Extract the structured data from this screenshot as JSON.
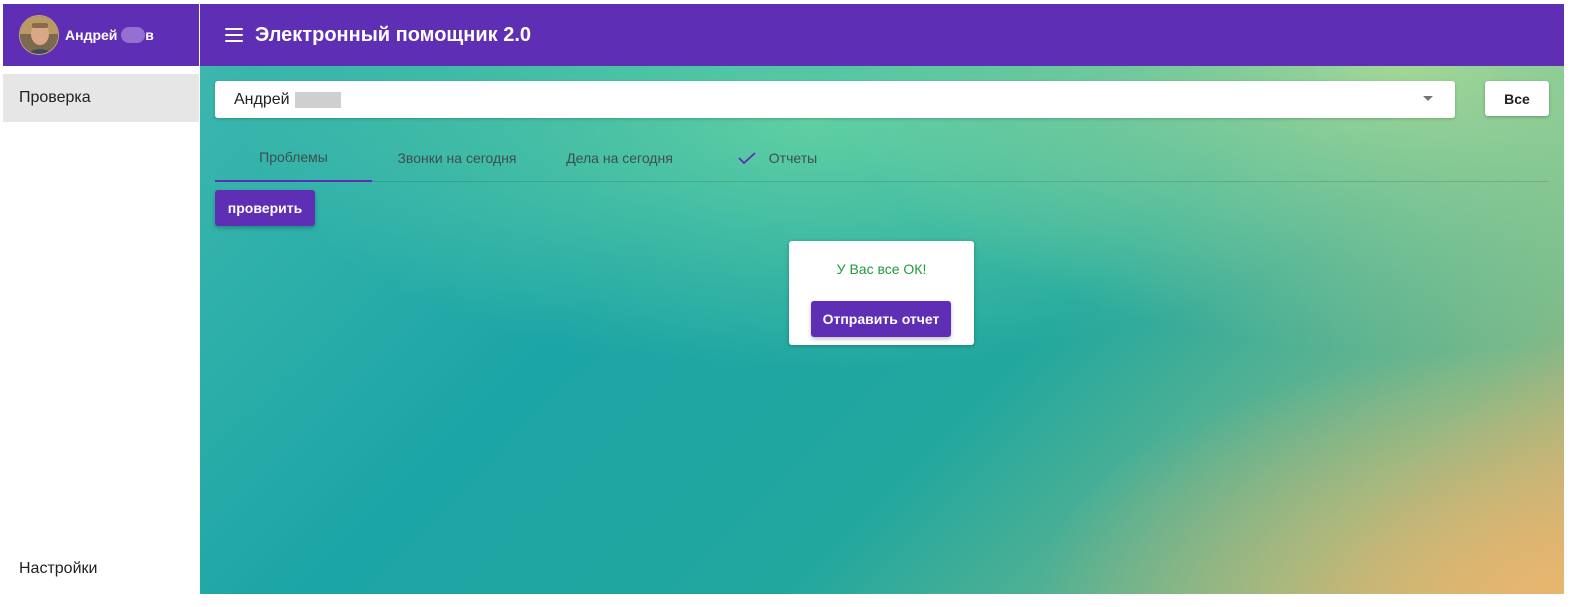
{
  "app": {
    "title": "Электронный помощник 2.0"
  },
  "user": {
    "name_start": "Андрей ",
    "name_end": "в"
  },
  "sidebar": {
    "items": [
      {
        "label": "Проверка",
        "active": true
      }
    ],
    "settings_label": "Настройки"
  },
  "selector": {
    "value": "Андрей",
    "icon": "caret-down-icon"
  },
  "toolbar": {
    "all_label": "Все"
  },
  "tabs": [
    {
      "label": "Проблемы",
      "active": true
    },
    {
      "label": "Звонки на сегодня",
      "active": false
    },
    {
      "label": "Дела на сегодня",
      "active": false
    },
    {
      "label": "Отчеты",
      "active": false,
      "icon": "check-icon"
    }
  ],
  "actions": {
    "check_label": "проверить"
  },
  "status_card": {
    "message": "У Вас все ОК!",
    "send_label": "Отправить отчет"
  },
  "colors": {
    "primary": "#5e2eb4",
    "success_text": "#1f9c3a",
    "sidebar_active_bg": "#e6e6e6"
  }
}
